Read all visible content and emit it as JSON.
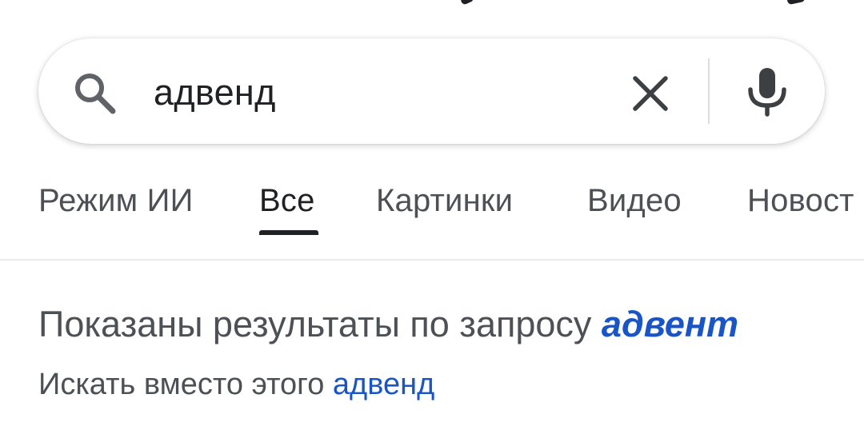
{
  "search": {
    "query": "адвенд",
    "clear_icon": "close-icon",
    "voice_icon": "microphone-icon",
    "search_icon": "search-icon"
  },
  "tabs": [
    {
      "label": "Режим ИИ",
      "active": false
    },
    {
      "label": "Все",
      "active": true
    },
    {
      "label": "Картинки",
      "active": false
    },
    {
      "label": "Видео",
      "active": false
    },
    {
      "label": "Новост",
      "active": false
    }
  ],
  "correction": {
    "prefix": "Показаны результаты по запросу",
    "corrected_query": "адвент",
    "search_instead_prefix": "Искать вместо этого",
    "original_query": "адвенд"
  },
  "colors": {
    "text_primary": "#202124",
    "text_secondary": "#4d5156",
    "link": "#1a55c8",
    "divider": "#ebebeb"
  }
}
